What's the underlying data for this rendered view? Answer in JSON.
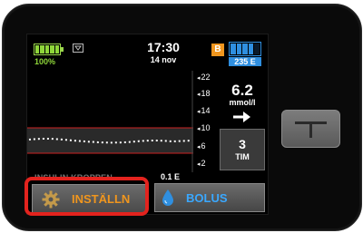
{
  "status": {
    "battery_percent": "100%",
    "time": "17:30",
    "date": "14 nov",
    "bolus_badge": "B",
    "insulin_remaining": "235 E"
  },
  "graph": {
    "scale_labels": [
      "22",
      "18",
      "14",
      "10",
      "6",
      "2"
    ]
  },
  "glucose": {
    "value": "6.2",
    "unit": "mmol/l",
    "trend_hours": "3",
    "trend_hours_unit": "TIM"
  },
  "iob": {
    "label": "INSULIN KROPPEN",
    "value": "0.1 E"
  },
  "buttons": {
    "settings_label": "INSTÄLLN",
    "bolus_label": "BOLUS"
  },
  "icons": {
    "battery": "battery-icon",
    "signal": "signal-icon",
    "activity": "exercise-icon",
    "status": "diamond-icon",
    "trend": "arrow-right-icon",
    "settings": "gear-icon",
    "bolus": "drop-icon",
    "home": "t-logo-icon"
  },
  "colors": {
    "battery_green": "#8fd63a",
    "accent_orange": "#f0961e",
    "insulin_blue": "#2f8fe0",
    "highlight_red": "#e3231e"
  }
}
